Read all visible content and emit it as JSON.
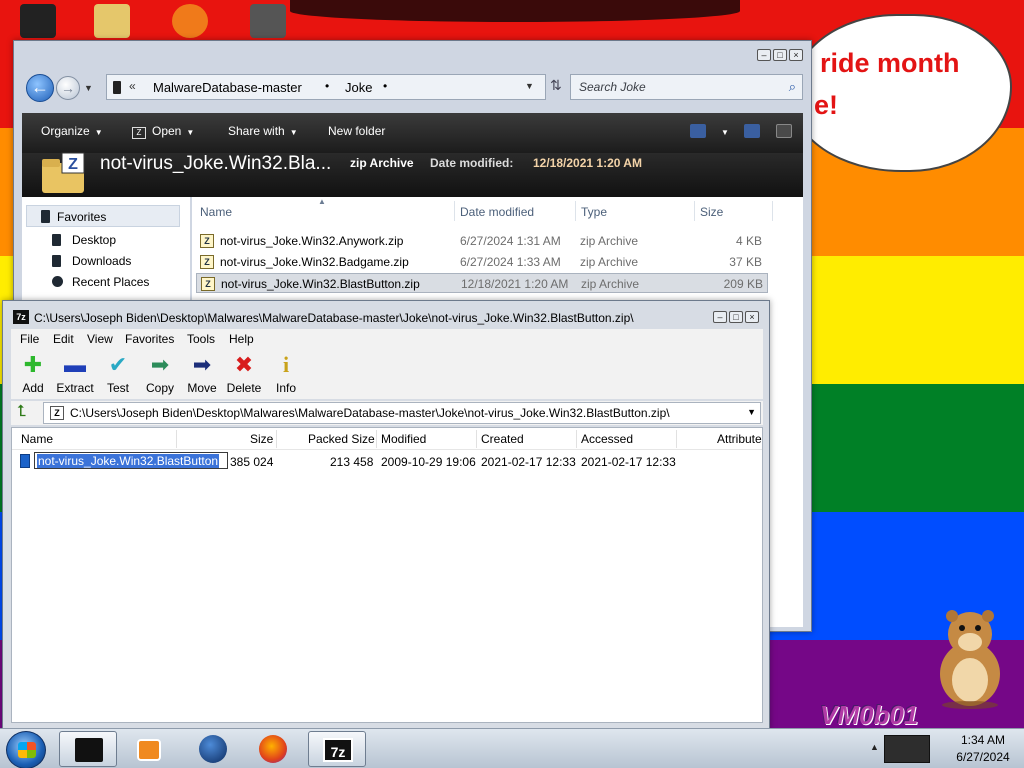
{
  "colors": {
    "stripe_red": "#e8140f",
    "stripe_orange": "#ff8c00",
    "stripe_yellow": "#ffed00",
    "stripe_green": "#008026",
    "stripe_blue": "#004dff",
    "stripe_purple": "#750787",
    "bubble_text": "#e31414",
    "selection": "#3b73d9"
  },
  "bubble": {
    "line1": "ride month",
    "line2": "e!"
  },
  "explorer": {
    "breadcrumb": [
      "MalwareDatabase-master",
      "Joke"
    ],
    "search_placeholder": "Search Joke",
    "commands": {
      "organize": "Organize",
      "open": "Open",
      "share_with": "Share with",
      "new_folder": "New folder"
    },
    "details": {
      "name": "not-virus_Joke.Win32.Bla...",
      "type": "zip Archive",
      "modified_label": "Date modified:",
      "modified_value": "12/18/2021 1:20 AM"
    },
    "nav": {
      "favorites": "Favorites",
      "items": [
        "Desktop",
        "Downloads",
        "Recent Places"
      ]
    },
    "columns": {
      "name": "Name",
      "date_modified": "Date modified",
      "type": "Type",
      "size": "Size"
    },
    "files": [
      {
        "name": "not-virus_Joke.Win32.Anywork.zip",
        "date": "6/27/2024 1:31 AM",
        "type": "zip Archive",
        "size": "4 KB"
      },
      {
        "name": "not-virus_Joke.Win32.Badgame.zip",
        "date": "6/27/2024 1:33 AM",
        "type": "zip Archive",
        "size": "37 KB"
      },
      {
        "name": "not-virus_Joke.Win32.BlastButton.zip",
        "date": "12/18/2021 1:20 AM",
        "type": "zip Archive",
        "size": "209 KB"
      }
    ]
  },
  "sevenzip": {
    "title": "C:\\Users\\Joseph Biden\\Desktop\\Malwares\\MalwareDatabase-master\\Joke\\not-virus_Joke.Win32.BlastButton.zip\\",
    "menu": [
      "File",
      "Edit",
      "View",
      "Favorites",
      "Tools",
      "Help"
    ],
    "toolbar": [
      "Add",
      "Extract",
      "Test",
      "Copy",
      "Move",
      "Delete",
      "Info"
    ],
    "address": "C:\\Users\\Joseph Biden\\Desktop\\Malwares\\MalwareDatabase-master\\Joke\\not-virus_Joke.Win32.BlastButton.zip\\",
    "columns": {
      "name": "Name",
      "size": "Size",
      "packed": "Packed Size",
      "modified": "Modified",
      "created": "Created",
      "accessed": "Accessed",
      "attributes": "Attribute"
    },
    "row": {
      "name": "not-virus_Joke.Win32.BlastButton",
      "size": "385 024",
      "packed": "213 458",
      "modified": "2009-10-29 19:06",
      "created": "2021-02-17 12:33",
      "accessed": "2021-02-17 12:33"
    }
  },
  "desktop_label": "VM0b01",
  "taskbar": {
    "time": "1:34 AM",
    "date": "6/27/2024"
  }
}
